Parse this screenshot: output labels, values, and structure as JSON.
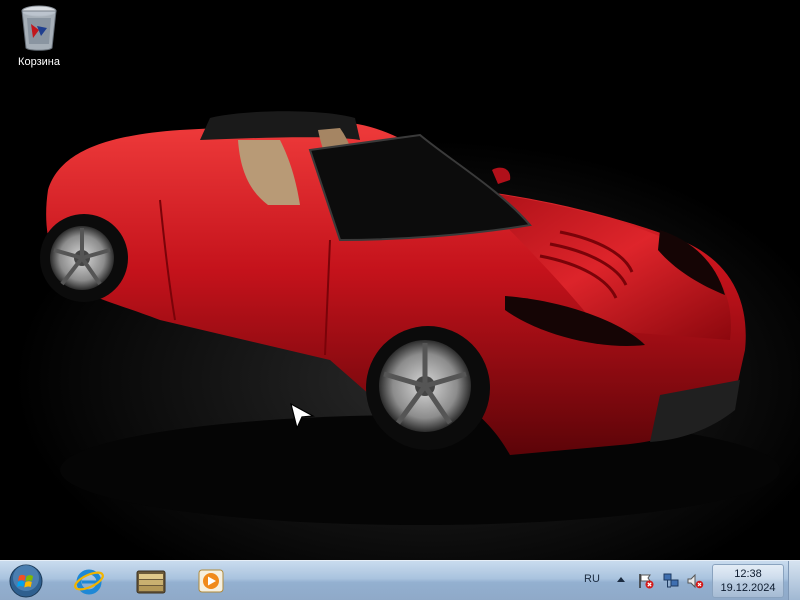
{
  "desktop": {
    "icons": [
      {
        "label": "Корзина",
        "icon": "recycle-bin-icon"
      }
    ]
  },
  "taskbar": {
    "start_icon": "windows-start-orb-icon",
    "pinned": [
      {
        "icon": "internet-explorer-icon"
      },
      {
        "icon": "windows-explorer-icon"
      },
      {
        "icon": "windows-media-player-icon"
      }
    ],
    "tray": {
      "language": "RU",
      "icons": [
        "action-center-flag-icon",
        "network-icon",
        "volume-muted-icon"
      ]
    },
    "clock": {
      "time": "12:38",
      "date": "19.12.2024"
    }
  },
  "colors": {
    "taskbar": "#a9c3de",
    "car_red": "#c4121b"
  }
}
